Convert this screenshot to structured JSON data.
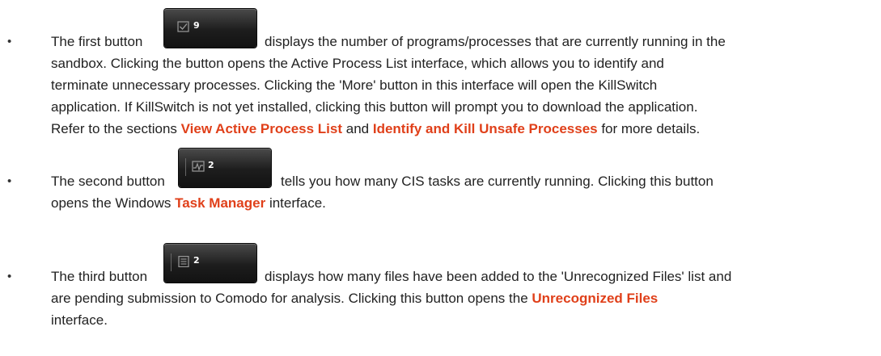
{
  "items": [
    {
      "lead": "The first button",
      "button": {
        "icon": "checkbox-icon",
        "count": "9"
      },
      "line1_tail": "displays the number of programs/processes that are currently running in the",
      "line2": "sandbox. Clicking the button opens the Active Process List interface, which allows you to identify and",
      "line3": "terminate unnecessary processes. Clicking the 'More' button in this interface will open the KillSwitch",
      "line4": "application. If KillSwitch is not yet installed, clicking this button will prompt you to download the application.",
      "line5_pre": "Refer to the sections ",
      "link1": "View Active Process List",
      "line5_mid": " and ",
      "link2": "Identify and Kill Unsafe Processes",
      "line5_post": " for more details."
    },
    {
      "lead": "The second button",
      "button": {
        "icon": "activity-graph-icon",
        "count": "2"
      },
      "line1_tail": "tells you how many CIS tasks are currently running. Clicking this button",
      "line2_pre": "opens the Windows ",
      "link1": "Task Manager",
      "line2_post": " interface."
    },
    {
      "lead": "The third button",
      "button": {
        "icon": "document-icon",
        "count": "2"
      },
      "line1_tail": "displays how many files have been added to the 'Unrecognized Files' list and",
      "line2_pre": "are pending submission to Comodo for analysis. Clicking this button opens the ",
      "link1": "Unrecognized Files",
      "line3": "interface."
    }
  ],
  "link_color": "#e0401a",
  "bullet_char": "•"
}
